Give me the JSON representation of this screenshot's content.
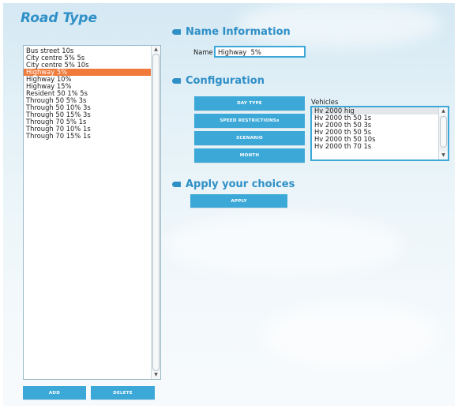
{
  "road_type": {
    "title": "Road Type",
    "items": [
      {
        "label": "Bus street 10s",
        "selected": false
      },
      {
        "label": "City centre 5% 5s",
        "selected": false
      },
      {
        "label": "City centre 5% 10s",
        "selected": false
      },
      {
        "label": "Highway 5%",
        "selected": true
      },
      {
        "label": "Highway 10%",
        "selected": false
      },
      {
        "label": "Highway 15%",
        "selected": false
      },
      {
        "label": "Resident 50 1% 5s",
        "selected": false
      },
      {
        "label": "Through 50 5% 3s",
        "selected": false
      },
      {
        "label": "Through 50 10% 3s",
        "selected": false
      },
      {
        "label": "Through 50 15% 3s",
        "selected": false
      },
      {
        "label": "Through 70 5% 1s",
        "selected": false
      },
      {
        "label": "Through 70 10% 1s",
        "selected": false
      },
      {
        "label": "Through 70 15% 1s",
        "selected": false
      }
    ],
    "add_label": "ADD",
    "delete_label": "DELETE"
  },
  "name_information": {
    "title": "Name Information",
    "name_label": "Name",
    "name_value": "Highway  5%"
  },
  "configuration": {
    "title": "Configuration",
    "buttons": [
      "DAY TYPE",
      "SPEED RESTRICTIONSs",
      "SCENARIO",
      "MONTH"
    ],
    "vehicles_label": "Vehicles",
    "vehicles": [
      {
        "label": "Hv 2000 hig",
        "selected": true
      },
      {
        "label": "Hv 2000 th 50 1s",
        "selected": false
      },
      {
        "label": "Hv 2000 th 50 3s",
        "selected": false
      },
      {
        "label": "Hv 2000 th 50 5s",
        "selected": false
      },
      {
        "label": "Hv 2000 th 50 10s",
        "selected": false
      },
      {
        "label": "Hv 2000 th 70 1s",
        "selected": false
      }
    ]
  },
  "apply": {
    "title": "Apply your choices",
    "button_label": "APPLY"
  },
  "colors": {
    "accent": "#2f8fc7",
    "button": "#3ba8d8",
    "selection": "#f07a3a"
  }
}
